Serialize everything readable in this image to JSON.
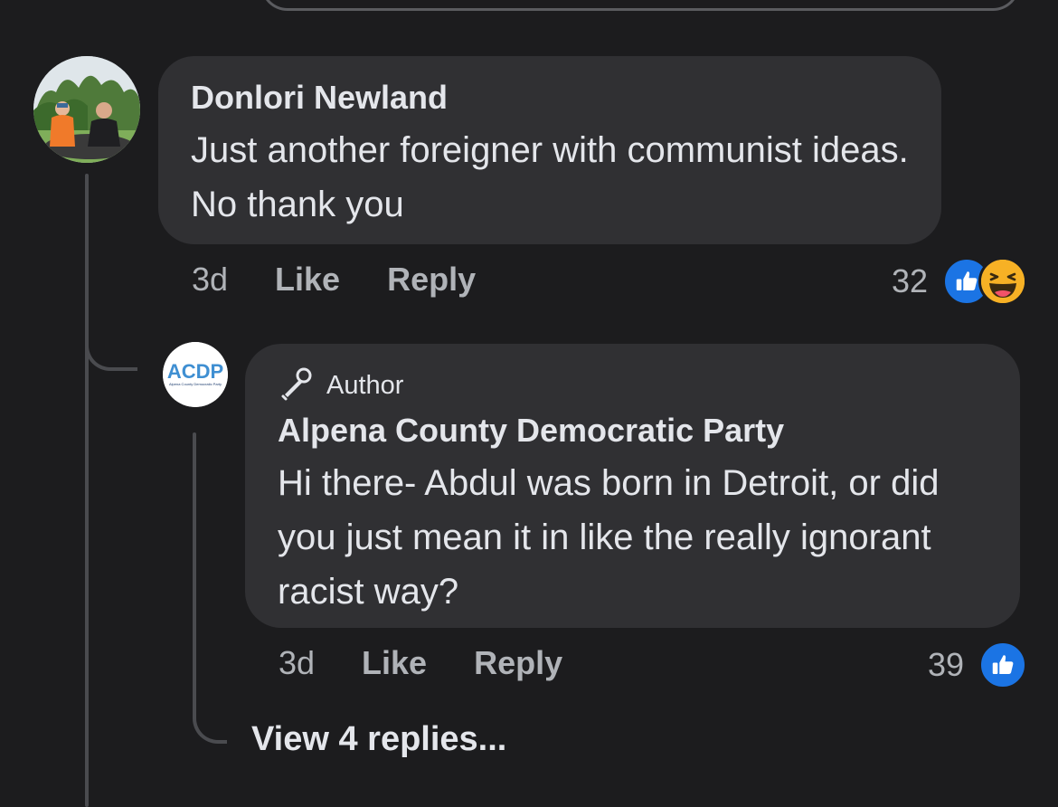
{
  "comment": {
    "author": "Donlori Newland",
    "text": "Just another foreigner with communist ideas. No thank you",
    "timestamp": "3d",
    "like_label": "Like",
    "reply_label": "Reply",
    "reaction_count": "32",
    "reactions": [
      "thumbs-up-icon",
      "laughing-face-icon"
    ],
    "avatar_icon": "user-photo-avatar"
  },
  "reply": {
    "badge_label": "Author",
    "badge_icon": "microphone-icon",
    "author": "Alpena County Democratic Party",
    "avatar_logo_text": "ACDP",
    "avatar_logo_subtext": "Alpena County Democratic Party",
    "text": "Hi there- Abdul was born in Detroit, or did you just mean it in like the really ignorant racist way?",
    "timestamp": "3d",
    "like_label": "Like",
    "reply_label": "Reply",
    "reaction_count": "39",
    "reactions": [
      "thumbs-up-icon"
    ]
  },
  "view_replies_label": "View 4 replies...",
  "colors": {
    "background": "#1c1c1e",
    "bubble": "#303033",
    "primary_text": "#e4e6eb",
    "secondary_text": "#b0b3b8",
    "like_blue": "#1b74e4",
    "haha_yellow": "#f7b125"
  }
}
